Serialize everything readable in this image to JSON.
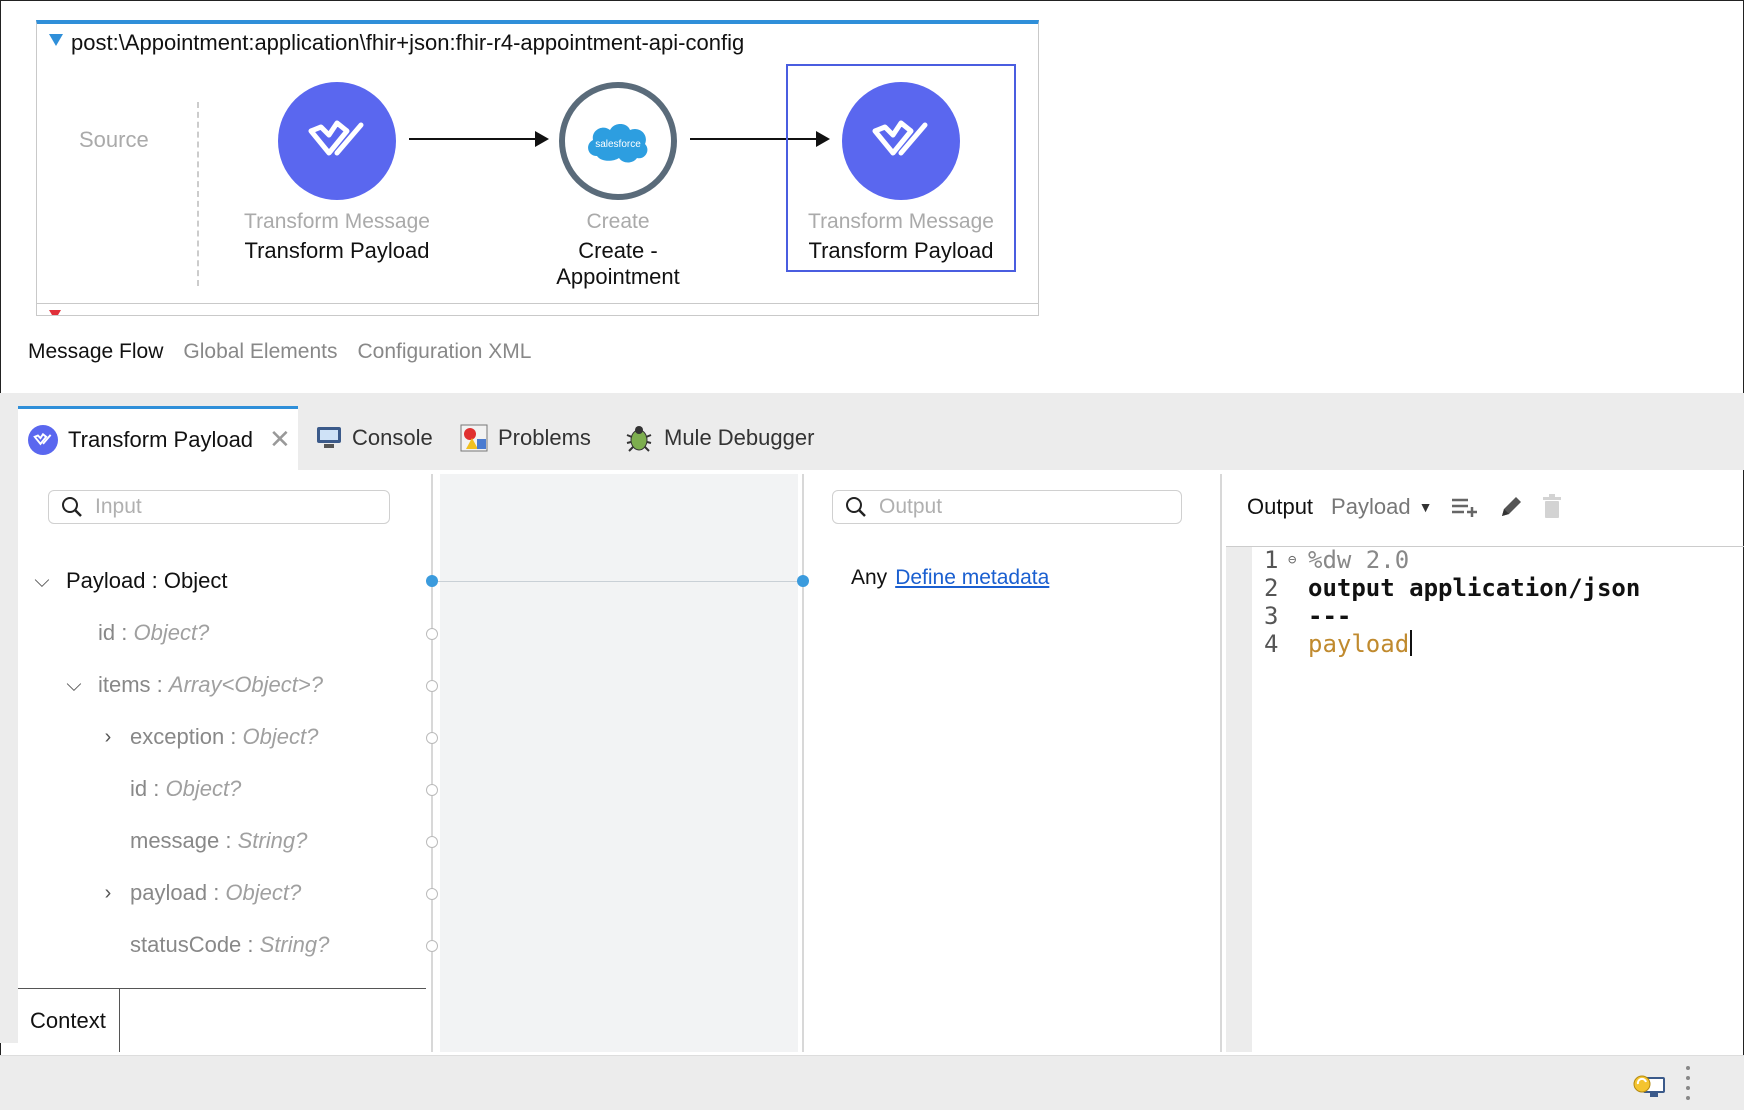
{
  "flow": {
    "title": "post:\\Appointment:application\\fhir+json:fhir-r4-appointment-api-config",
    "source_label": "Source",
    "nodes": [
      {
        "type": "Transform Message",
        "name": "Transform Payload",
        "icon": "dataweave-icon"
      },
      {
        "type": "Create",
        "name": "Create - Appointment",
        "icon": "salesforce-icon",
        "logo_text": "salesforce"
      },
      {
        "type": "Transform Message",
        "name": "Transform Payload",
        "icon": "dataweave-icon"
      }
    ]
  },
  "editor_tabs": [
    "Message Flow",
    "Global Elements",
    "Configuration XML"
  ],
  "panel_tabs": [
    {
      "label": "Transform Payload",
      "icon": "dataweave-icon"
    },
    {
      "label": "Console",
      "icon": "console-icon"
    },
    {
      "label": "Problems",
      "icon": "problems-icon"
    },
    {
      "label": "Mule Debugger",
      "icon": "debugger-icon"
    }
  ],
  "input_panel": {
    "search_placeholder": "Input",
    "tree": [
      {
        "name": "Payload",
        "type": "Object",
        "root": true
      },
      {
        "name": "id",
        "type": "Object?"
      },
      {
        "name": "items",
        "type": "Array<Object>?"
      },
      {
        "name": "exception",
        "type": "Object?"
      },
      {
        "name": "id",
        "type": "Object?"
      },
      {
        "name": "message",
        "type": "String?"
      },
      {
        "name": "payload",
        "type": "Object?"
      },
      {
        "name": "statusCode",
        "type": "String?"
      }
    ],
    "context_tab": "Context"
  },
  "output_panel": {
    "search_placeholder": "Output",
    "any_label": "Any",
    "define_metadata": "Define metadata"
  },
  "script_panel": {
    "output_label": "Output",
    "payload_dropdown": "Payload",
    "code": [
      {
        "ln": "1",
        "text": "%dw 2.0"
      },
      {
        "ln": "2",
        "text": "output application/json"
      },
      {
        "ln": "3",
        "text": "---"
      },
      {
        "ln": "4",
        "text": "payload"
      }
    ]
  },
  "colors": {
    "accent": "#2f8fd9",
    "dataweave": "#5a67ef",
    "selection": "#4a5de0",
    "port": "#3b9bdd"
  }
}
